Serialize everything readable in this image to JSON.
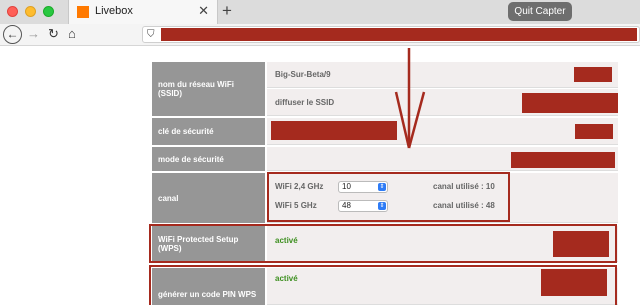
{
  "browser": {
    "tab_title": "Livebox",
    "tab_close": "✕",
    "new_tab": "+",
    "quit_button": "Quit Capter"
  },
  "toolbar": {
    "back_icon": "←",
    "forward_icon": "→",
    "reload_icon": "↻",
    "home_icon": "⌂",
    "shield_icon": "⛉"
  },
  "rows": {
    "ssid_label": "nom du réseau WiFi (SSID)",
    "ssid_value": "Big-Sur-Beta/9",
    "broadcast_ssid": "diffuser le SSID",
    "security_key_label": "clé de sécurité",
    "security_mode_label": "mode de sécurité",
    "channel_label": "canal",
    "wifi24_label": "WiFi 2,4 GHz",
    "wifi24_select": "10",
    "wifi24_used": "canal utilisé : 10",
    "wifi5_label": "WiFi 5 GHz",
    "wifi5_select": "48",
    "wifi5_used": "canal utilisé : 48",
    "wps_label": "WiFi Protected Setup (WPS)",
    "wps_value": "activé",
    "pin_label": "générer un code PIN WPS",
    "pin_value": "activé"
  },
  "colors": {
    "redaction": "#a52a1e",
    "label_bg": "#969696",
    "active_green": "#3d8f1f"
  }
}
